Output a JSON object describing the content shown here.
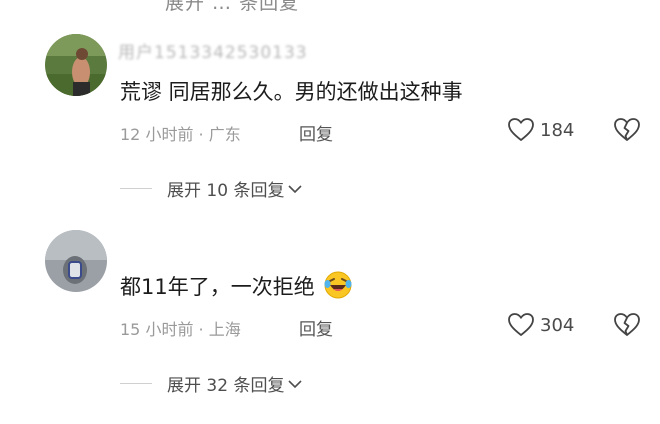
{
  "top_partial": "展开 … 条回复",
  "comments": [
    {
      "username": "用户1513342530133",
      "content": "荒谬 同居那么久。男的还做出这种事",
      "emoji": "",
      "time": "12 小时前",
      "location": "广东",
      "reply_label": "回复",
      "likes": "184",
      "expand_label": "展开 10 条回复"
    },
    {
      "username": "",
      "content": "都11年了，一次拒绝",
      "emoji": "laughing-tears-emoji",
      "time": "15 小时前",
      "location": "上海",
      "reply_label": "回复",
      "likes": "304",
      "expand_label": "展开 32 条回复"
    }
  ],
  "colors": {
    "text_primary": "#1c1c1c",
    "text_meta": "#9a9a9a",
    "icon_stroke": "#444444"
  }
}
